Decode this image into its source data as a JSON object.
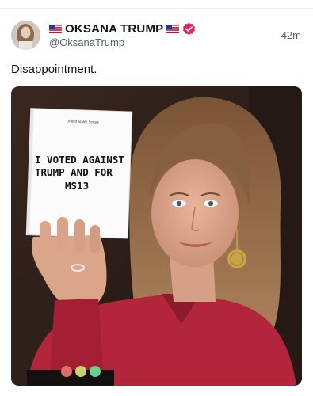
{
  "post": {
    "author": {
      "display_name": "OKSANA TRUMP",
      "handle": "@OksanaTrump",
      "verified": true,
      "name_flags": "us-flag-icon"
    },
    "timestamp": "42m",
    "text": "Disappointment.",
    "media": {
      "sign_header": "United States Senate",
      "sign_lines": [
        "I VOTED AGAINST",
        "TRUMP AND FOR",
        "MS13"
      ]
    }
  },
  "colors": {
    "verified_badge": "#e0245e",
    "secondary_text": "#536471",
    "media_background": "#2a1c17",
    "jacket_red": "#b2253a"
  }
}
